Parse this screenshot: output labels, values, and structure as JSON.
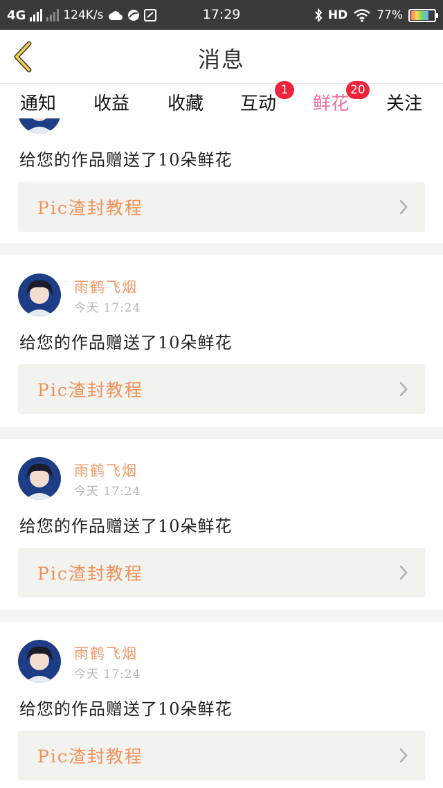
{
  "status_bar": {
    "network": "4G",
    "speed": "124K/s",
    "time": "17:29",
    "hd": "HD",
    "battery": "77%",
    "battery_level": 0.77,
    "icons": [
      "signal-icon",
      "weather-icon",
      "app-icon",
      "screenshot-icon",
      "bluetooth-icon",
      "wifi-icon",
      "battery-icon"
    ]
  },
  "header": {
    "title": "消息",
    "back_icon": "chevron-left-icon"
  },
  "tabs": [
    {
      "label": "通知",
      "badge": ""
    },
    {
      "label": "收益",
      "badge": ""
    },
    {
      "label": "收藏",
      "badge": ""
    },
    {
      "label": "互动",
      "badge": "1"
    },
    {
      "label": "鲜花",
      "badge": "20",
      "active": true
    },
    {
      "label": "关注",
      "badge": ""
    }
  ],
  "messages": [
    {
      "user": "",
      "time": "",
      "text": "给您的作品赠送了10朵鲜花",
      "work_title": "Pic渣封教程"
    },
    {
      "user": "雨鹤飞烟",
      "time": "今天 17:24",
      "text": "给您的作品赠送了10朵鲜花",
      "work_title": "Pic渣封教程"
    },
    {
      "user": "雨鹤飞烟",
      "time": "今天 17:24",
      "text": "给您的作品赠送了10朵鲜花",
      "work_title": "Pic渣封教程"
    },
    {
      "user": "雨鹤飞烟",
      "time": "今天 17:24",
      "text": "给您的作品赠送了10朵鲜花",
      "work_title": "Pic渣封教程"
    }
  ],
  "colors": {
    "accent": "#ec6d9e",
    "badge": "#f0233b",
    "username": "#f29a67",
    "work_title": "#f0915a"
  }
}
